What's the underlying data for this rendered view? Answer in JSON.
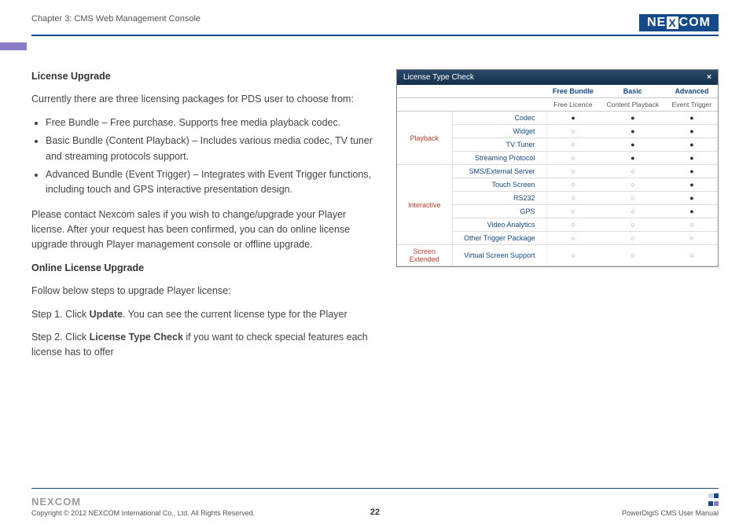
{
  "header": {
    "chapter": "Chapter 3: CMS Web Management Console",
    "logo_pre": "NE",
    "logo_x": "X",
    "logo_post": "COM"
  },
  "content": {
    "h_license": "License Upgrade",
    "intro": "Currently there are three licensing packages for PDS user to choose from:",
    "bullets": [
      "Free Bundle – Free purchase. Supports free media playback codec.",
      "Basic Bundle (Content Playback) – Includes various media codec, TV tuner and streaming protocols support.",
      "Advanced Bundle (Event Trigger) – Integrates with Event Trigger functions, including touch and GPS interactive presentation design."
    ],
    "contact": "Please contact Nexcom sales if you wish to change/upgrade your Player license. After your request has been confirmed, you can do online license upgrade through Player management console or offline upgrade.",
    "h_online": "Online License Upgrade",
    "follow": "Follow below steps to upgrade Player license:",
    "step1_a": "Step 1. Click ",
    "step1_b": "Update",
    "step1_c": ". You can see the current license type for the Player",
    "step2_a": "Step 2. Click ",
    "step2_b": "License Type Check",
    "step2_c": " if you want to check special features each license has to offer"
  },
  "panel": {
    "title": "License Type Check",
    "close": "×",
    "head": {
      "c1": "Free Bundle",
      "c2": "Basic",
      "c3": "Advanced"
    },
    "sub": {
      "c1": "Free Licence",
      "c2": "Content Playback",
      "c3": "Event Trigger"
    },
    "groups": [
      {
        "name": "Playback",
        "rows": [
          {
            "f": "Codec",
            "v": [
              "●",
              "●",
              "●"
            ]
          },
          {
            "f": "Widget",
            "v": [
              "○",
              "●",
              "●"
            ]
          },
          {
            "f": "TV Tuner",
            "v": [
              "○",
              "●",
              "●"
            ]
          },
          {
            "f": "Streaming Protocol",
            "v": [
              "○",
              "●",
              "●"
            ]
          }
        ]
      },
      {
        "name": "Interactive",
        "rows": [
          {
            "f": "SMS/External Server",
            "v": [
              "○",
              "○",
              "●"
            ]
          },
          {
            "f": "Touch Screen",
            "v": [
              "○",
              "○",
              "●"
            ]
          },
          {
            "f": "RS232",
            "v": [
              "○",
              "○",
              "●"
            ]
          },
          {
            "f": "GPS",
            "v": [
              "○",
              "○",
              "●"
            ]
          },
          {
            "f": "Video Analytics",
            "v": [
              "○",
              "○",
              "○"
            ]
          },
          {
            "f": "Other Trigger Package",
            "v": [
              "○",
              "○",
              "○"
            ]
          }
        ]
      },
      {
        "name": "Screen Extended",
        "rows": [
          {
            "f": "Virtual Screen Support",
            "v": [
              "○",
              "○",
              "○"
            ]
          }
        ]
      }
    ]
  },
  "footer": {
    "logo": "NEXCOM",
    "copyright": "Copyright © 2012 NEXCOM International Co., Ltd. All Rights Reserved.",
    "page": "22",
    "manual": "PowerDigiS CMS User Manual"
  }
}
